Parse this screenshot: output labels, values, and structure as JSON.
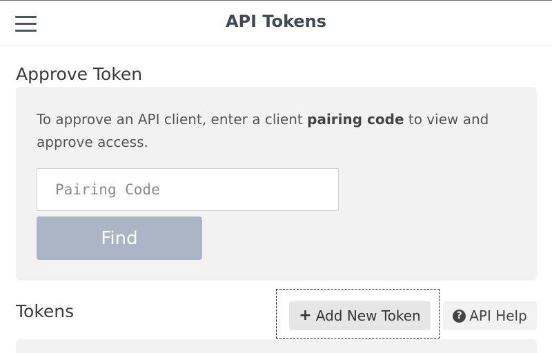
{
  "header": {
    "title": "API Tokens",
    "menu_icon": "hamburger-menu-icon"
  },
  "approve": {
    "heading": "Approve Token",
    "description_prefix": "To approve an API client, enter a client ",
    "description_bold": "pairing code",
    "description_suffix": " to view and approve access.",
    "input_placeholder": "Pairing Code",
    "input_value": "",
    "find_label": "Find"
  },
  "tokens": {
    "heading": "Tokens",
    "add_label": "Add New Token",
    "add_icon": "plus-icon",
    "help_label": "API Help",
    "help_icon": "question-circle-icon"
  },
  "colors": {
    "find_button_bg": "#abb5c5",
    "panel_bg": "#f2f2f2",
    "title_text": "#3f4a52"
  }
}
